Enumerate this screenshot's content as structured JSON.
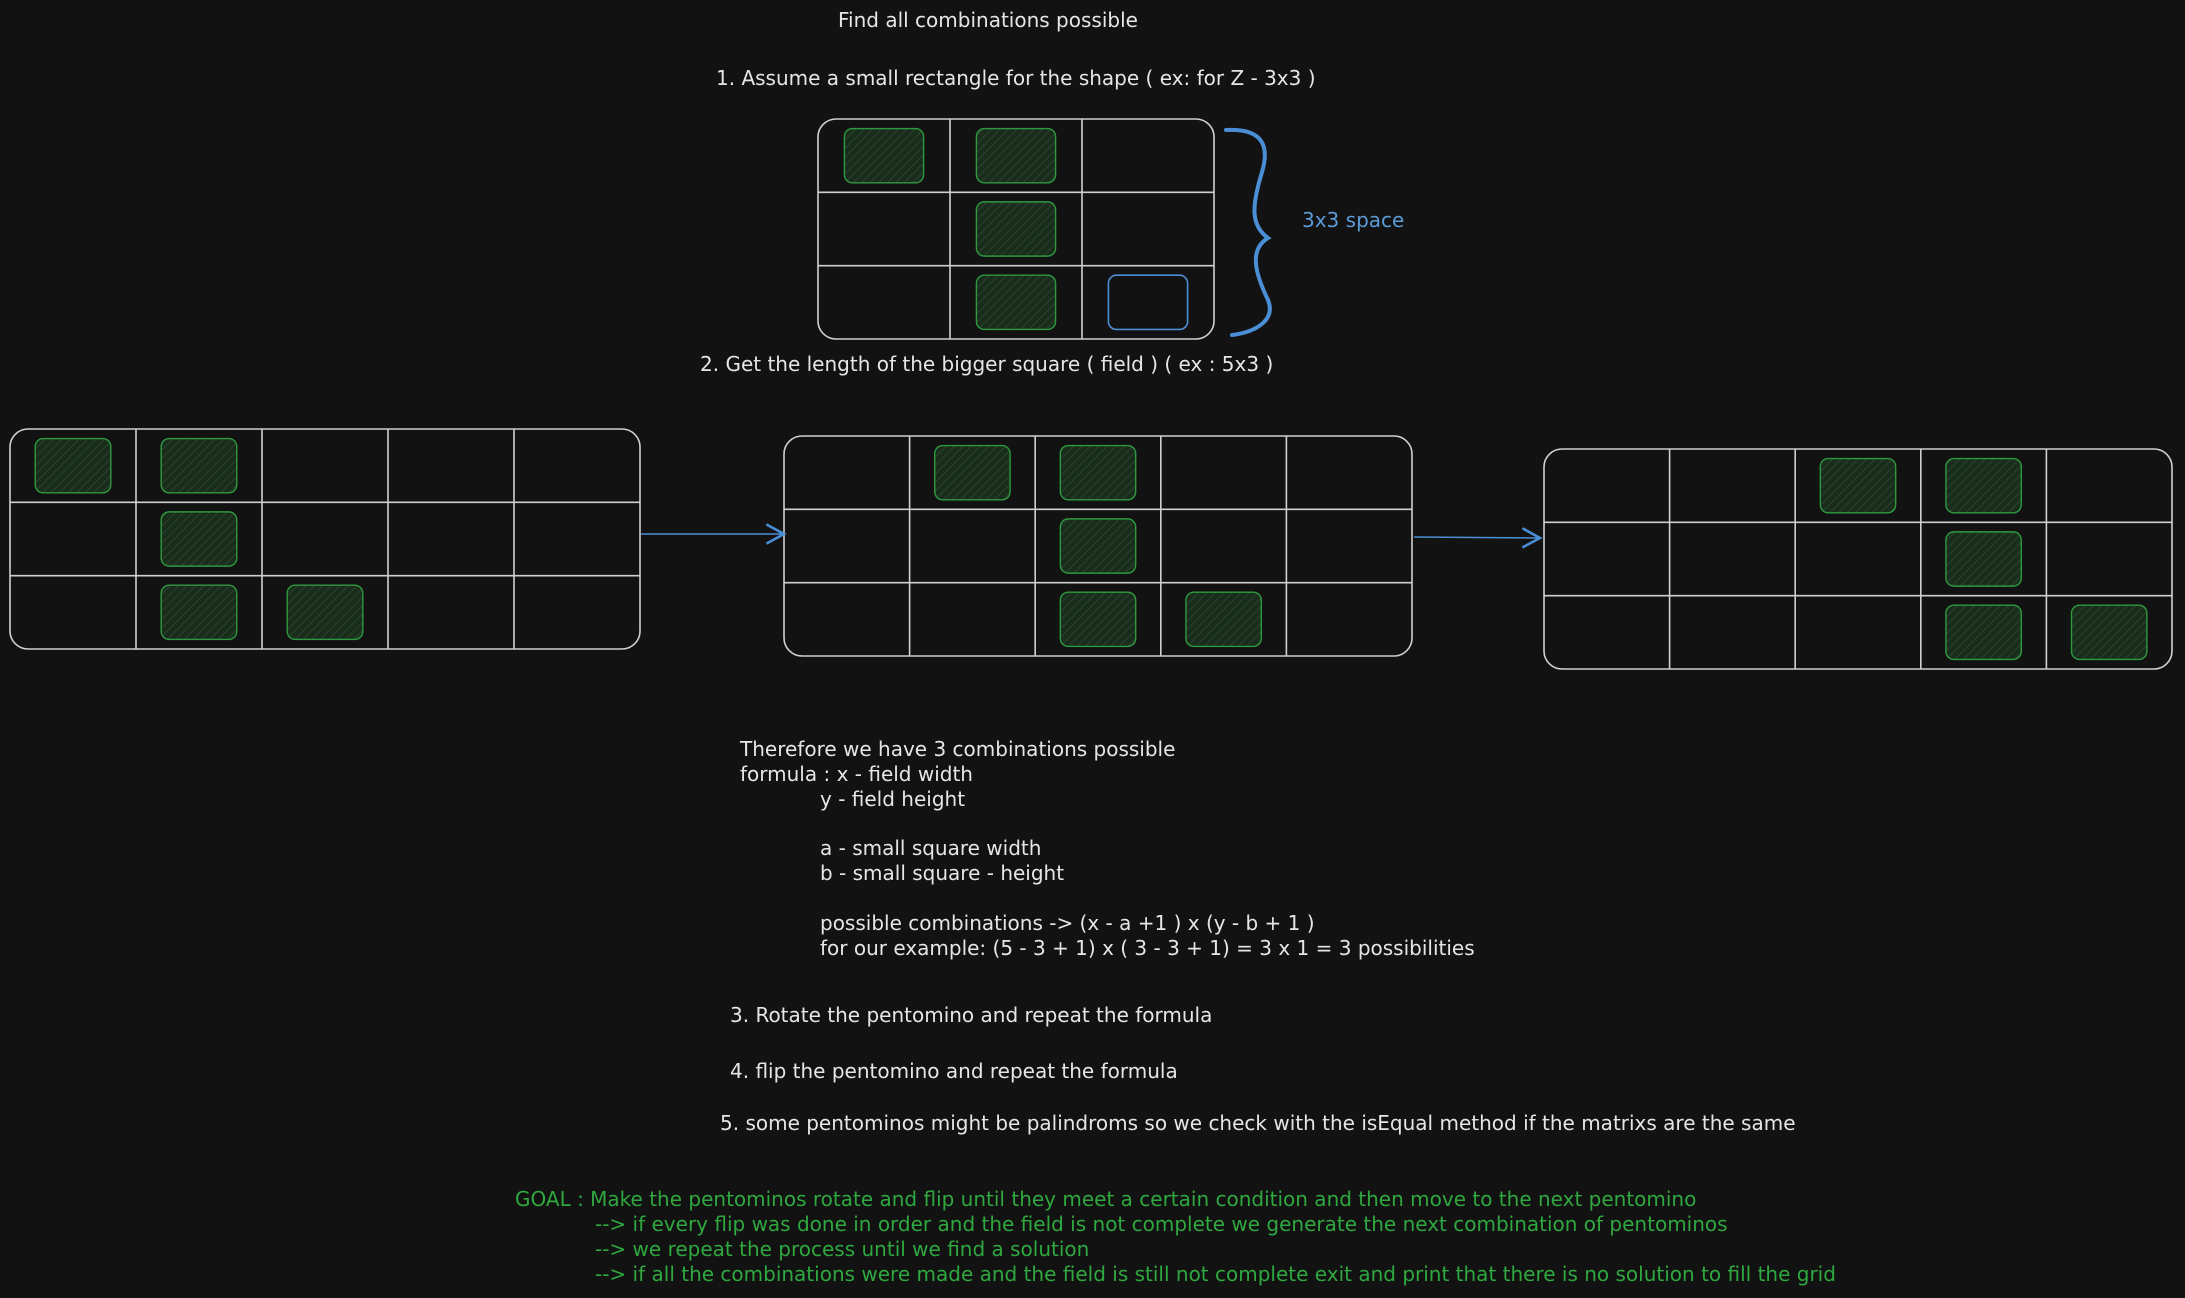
{
  "header": {
    "title": "Find all combinations possible",
    "step1": "1. Assume a small rectangle for the shape ( ex: for Z - 3x3 )",
    "space_label": "3x3 space",
    "step2": "2. Get the length of the bigger square ( field ) ( ex : 5x3 )"
  },
  "small_grid": {
    "cols": 3,
    "rows": 3,
    "filled": [
      [
        0,
        0
      ],
      [
        0,
        1
      ],
      [
        1,
        1
      ],
      [
        2,
        1
      ]
    ],
    "highlight": [
      [
        2,
        2
      ]
    ]
  },
  "field_grids": [
    {
      "cols": 5,
      "rows": 3,
      "filled": [
        [
          0,
          0
        ],
        [
          0,
          1
        ],
        [
          1,
          1
        ],
        [
          2,
          1
        ],
        [
          2,
          2
        ]
      ]
    },
    {
      "cols": 5,
      "rows": 3,
      "filled": [
        [
          0,
          1
        ],
        [
          0,
          2
        ],
        [
          1,
          2
        ],
        [
          2,
          2
        ],
        [
          2,
          3
        ]
      ]
    },
    {
      "cols": 5,
      "rows": 3,
      "filled": [
        [
          0,
          2
        ],
        [
          0,
          3
        ],
        [
          1,
          3
        ],
        [
          2,
          3
        ],
        [
          2,
          4
        ]
      ]
    }
  ],
  "explanation": {
    "line1": "Therefore we have 3 combinations possible",
    "line2": "formula : x - field width",
    "line3": "y - field height",
    "line4": "a - small square width",
    "line5": "b - small square - height",
    "line6": "possible combinations -> (x - a +1 ) x (y - b + 1 )",
    "line7": "for our example: (5 - 3 + 1) x ( 3 - 3 + 1) = 3 x 1 = 3 possibilities"
  },
  "steps": {
    "step3": "3. Rotate the pentomino and repeat the formula",
    "step4": "4. flip the pentomino and repeat the formula",
    "step5": "5. some pentominos might be palindroms so we check with the isEqual method if the matrixs are the same"
  },
  "goal": {
    "line1": "GOAL : Make the pentominos rotate and flip until they meet a certain condition and then move to the next pentomino",
    "line2": "--> if every flip was done in order and the field is not complete we generate the next combination of pentominos",
    "line3": "--> we repeat the process until we find a solution",
    "line4": "--> if all the combinations were made and the field is still not complete exit and print that there is no solution to fill the grid"
  },
  "colors": {
    "background": "#121212",
    "grid_stroke": "#d0d0d0",
    "cell_fill": "#1c3320",
    "cell_stroke": "#2e9a3e",
    "highlight_stroke": "#4a8fd6",
    "arrow": "#4a8fd6",
    "goal_text": "#2fa83f"
  }
}
